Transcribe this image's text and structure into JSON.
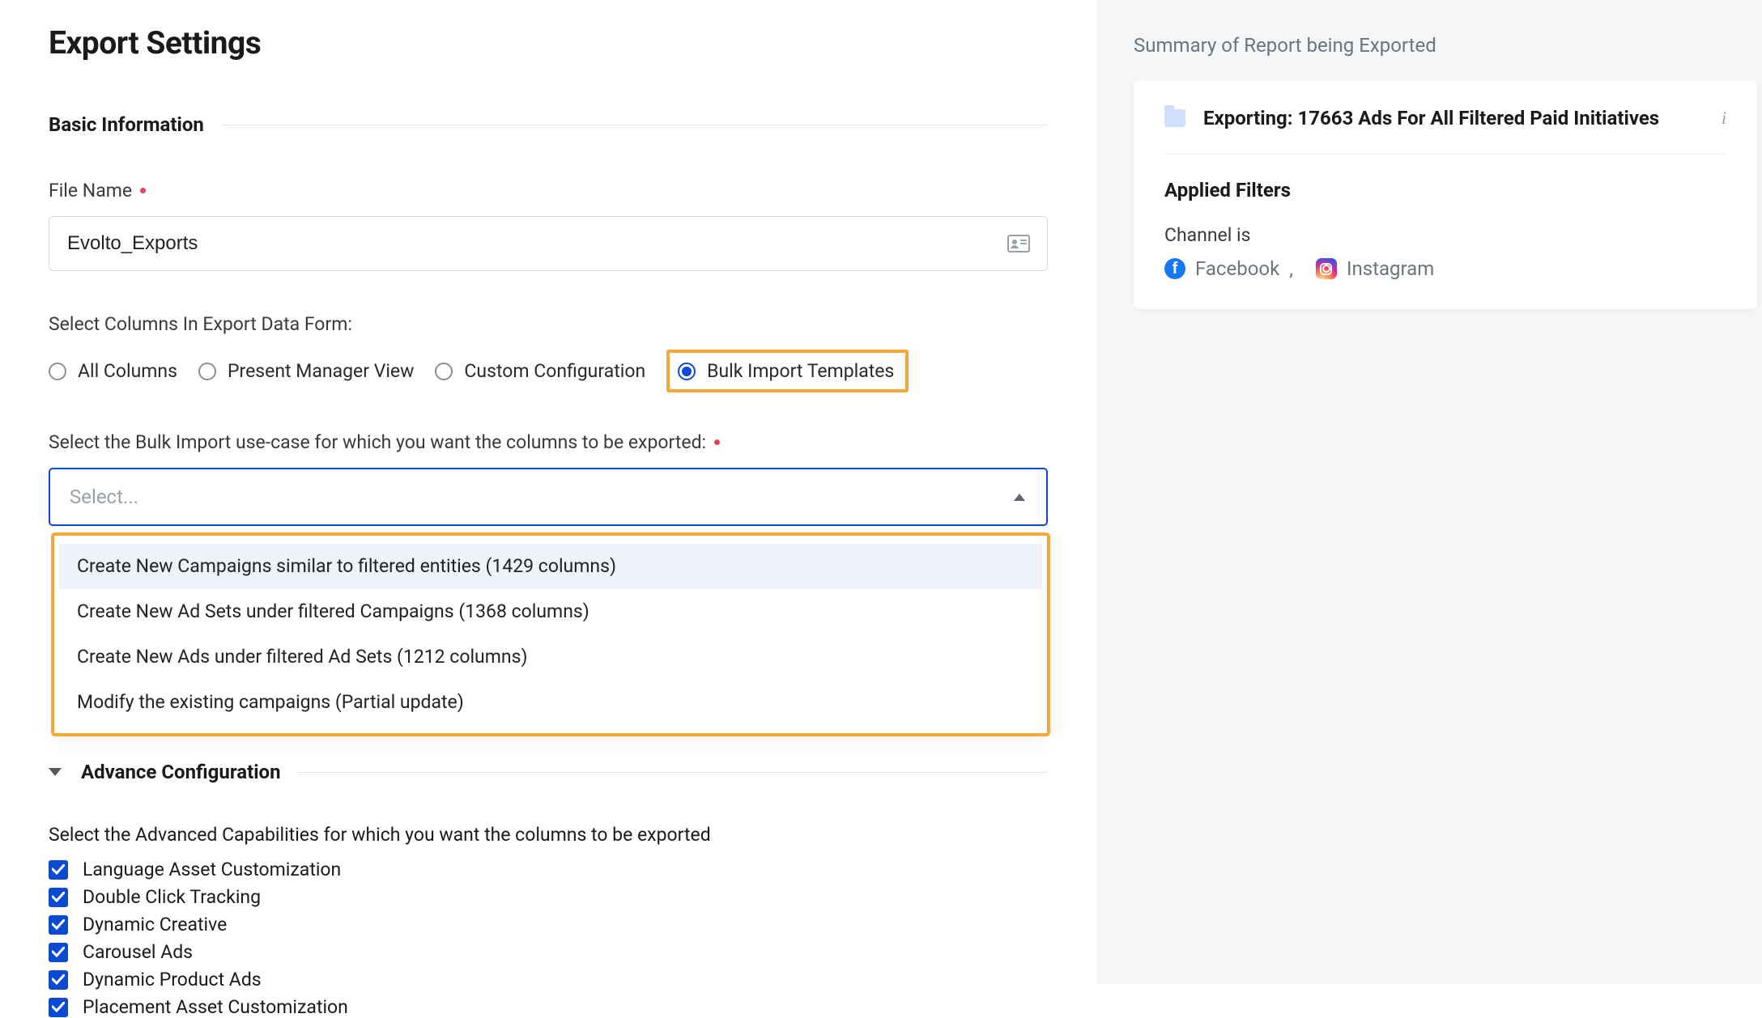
{
  "page": {
    "title": "Export Settings"
  },
  "basic": {
    "section_label": "Basic Information",
    "file_name_label": "File Name",
    "file_name_value": "Evolto_Exports",
    "columns_label": "Select Columns In Export Data Form:",
    "radio": {
      "all": "All Columns",
      "present": "Present Manager View",
      "custom": "Custom Configuration",
      "bulk": "Bulk Import Templates"
    },
    "usecase_label": "Select the Bulk Import use-case for which you want the columns to be exported:",
    "select_placeholder": "Select...",
    "options": [
      "Create New Campaigns similar to filtered entities (1429 columns)",
      "Create New Ad Sets under filtered Campaigns (1368 columns)",
      "Create New Ads under filtered Ad Sets (1212 columns)",
      "Modify the existing campaigns (Partial update)"
    ]
  },
  "advance": {
    "section_label": "Advance Configuration",
    "instruction": "Select the Advanced Capabilities for which you want the columns to be exported",
    "checks": [
      "Language Asset Customization",
      "Double Click Tracking",
      "Dynamic Creative",
      "Carousel Ads",
      "Dynamic Product Ads",
      "Placement Asset Customization"
    ]
  },
  "summary": {
    "title": "Summary of Report being Exported",
    "head": "Exporting: 17663 Ads For All Filtered Paid Initiatives",
    "filters_label": "Applied Filters",
    "channel_line": "Channel is",
    "channel1": "Facebook",
    "comma": ",",
    "channel2": "Instagram"
  }
}
